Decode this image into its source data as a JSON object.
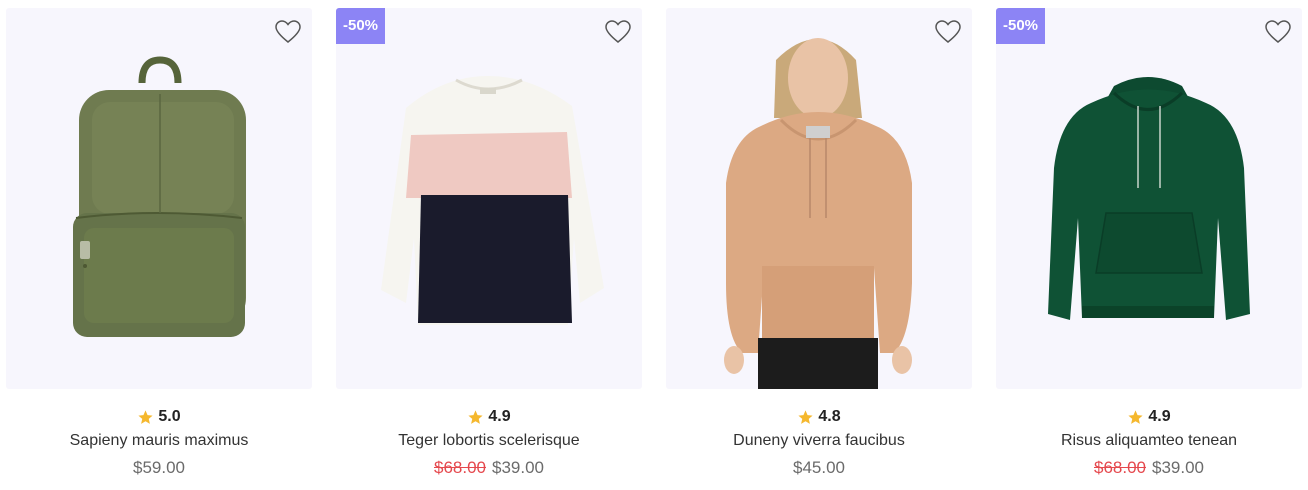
{
  "colors": {
    "card_background": "#f7f6fd",
    "badge_background": "#8c84f5",
    "star": "#f5b82e",
    "old_price": "#e5484d",
    "price": "#6b6b6b"
  },
  "products": [
    {
      "name": "Sapieny mauris maximus",
      "rating": "5.0",
      "price": "$59.00",
      "old_price": "",
      "badge": "",
      "image": "olive-green-backpack",
      "wishlist_icon": "heart-outline-icon"
    },
    {
      "name": "Teger lobortis scelerisque",
      "rating": "4.9",
      "price": "$39.00",
      "old_price": "$68.00",
      "badge": "-50%",
      "image": "colorblock-sweater",
      "wishlist_icon": "heart-outline-icon"
    },
    {
      "name": "Duneny viverra faucibus",
      "rating": "4.8",
      "price": "$45.00",
      "old_price": "",
      "badge": "",
      "image": "woman-in-tan-hoodie",
      "wishlist_icon": "heart-outline-icon"
    },
    {
      "name": "Risus aliquamteo tenean",
      "rating": "4.9",
      "price": "$39.00",
      "old_price": "$68.00",
      "badge": "-50%",
      "image": "green-hoodie",
      "wishlist_icon": "heart-outline-icon"
    }
  ]
}
